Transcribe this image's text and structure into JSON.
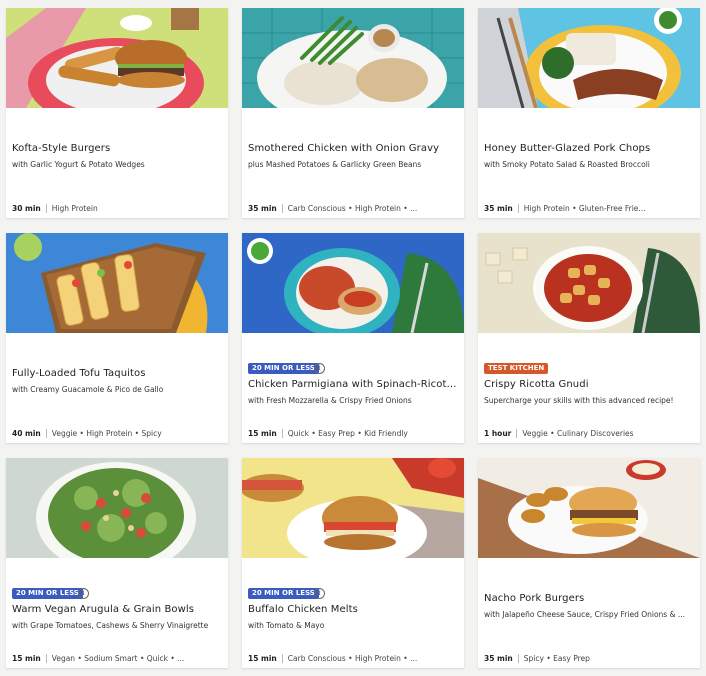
{
  "recipes": [
    {
      "title": "Kofta-Style Burgers",
      "subtitle": "with Garlic Yogurt & Potato Wedges",
      "time": "30 min",
      "tags": "High Protein",
      "badge": "",
      "image_icon": "burger-icon",
      "bg": "#cfe07a"
    },
    {
      "title": "Smothered Chicken with Onion Gravy",
      "subtitle": "plus Mashed Potatoes & Garlicky Green Beans",
      "time": "35 min",
      "tags": "Carb Conscious • High Protein • ...",
      "badge": "",
      "image_icon": "chicken-plate-icon",
      "bg": "#3aa4a8"
    },
    {
      "title": "Honey Butter-Glazed Pork Chops",
      "subtitle": "with Smoky Potato Salad & Roasted Broccoli",
      "time": "35 min",
      "tags": "High Protein • Gluten-Free Frie...",
      "badge": "",
      "image_icon": "pork-chop-plate-icon",
      "bg": "#5fc3e4"
    },
    {
      "title": "Fully-Loaded Tofu Taquitos",
      "subtitle": "with Creamy Guacamole & Pico de Gallo",
      "time": "40 min",
      "tags": "Veggie • High Protein • Spicy",
      "badge": "",
      "image_icon": "taquitos-board-icon",
      "bg": "#3e86d6"
    },
    {
      "title": "Chicken Parmigiana with Spinach-Ricott...",
      "subtitle": "with Fresh Mozzarella & Crispy Fried Onions",
      "time": "15 min",
      "tags": "Quick • Easy Prep • Kid Friendly",
      "badge": "20 MIN OR LESS",
      "badge_color": "blue",
      "image_icon": "pasta-plate-icon",
      "bg": "#2f67c7"
    },
    {
      "title": "Crispy Ricotta Gnudi",
      "subtitle": "Supercharge your skills with this advanced recipe!",
      "time": "1 hour",
      "tags": "Veggie • Culinary Discoveries",
      "badge": "TEST KITCHEN",
      "badge_color": "orange",
      "image_icon": "gnudi-bowl-icon",
      "bg": "#e8e2cc"
    },
    {
      "title": "Warm Vegan Arugula & Grain Bowls",
      "subtitle": "with Grape Tomatoes, Cashews & Sherry Vinaigrette",
      "time": "15 min",
      "tags": "Vegan • Sodium Smart • Quick • ...",
      "badge": "20 MIN OR LESS",
      "badge_color": "blue",
      "image_icon": "salad-bowl-icon",
      "bg": "#cfd8d0"
    },
    {
      "title": "Buffalo Chicken Melts",
      "subtitle": "with Tomato & Mayo",
      "time": "15 min",
      "tags": "Carb Conscious • High Protein • ...",
      "badge": "20 MIN OR LESS",
      "badge_color": "blue",
      "image_icon": "sandwich-plate-icon",
      "bg": "#f2e48a"
    },
    {
      "title": "Nacho Pork Burgers",
      "subtitle": "with Jalapeño Cheese Sauce, Crispy Fried Onions & ...",
      "time": "35 min",
      "tags": "Spicy • Easy Prep",
      "badge": "",
      "image_icon": "burger-board-icon",
      "bg": "#f1ece4"
    }
  ],
  "info_icon_glyph": "i"
}
